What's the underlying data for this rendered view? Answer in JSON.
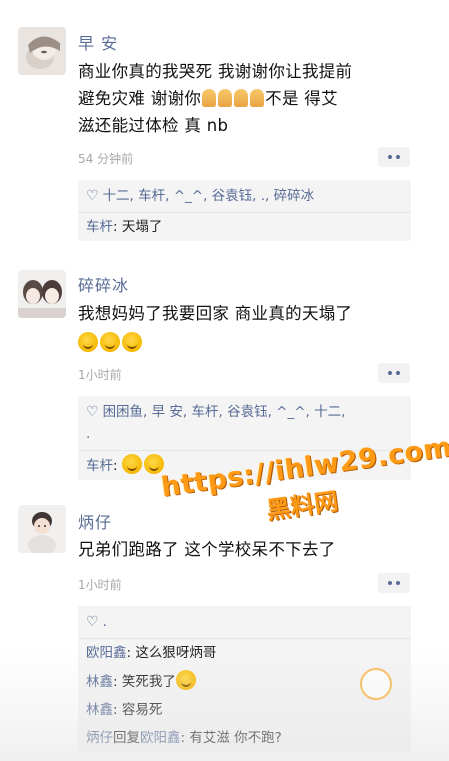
{
  "posts": [
    {
      "name": "早 安",
      "content_lines": [
        "商业你真的我哭死  我谢谢你让我提前",
        "避免灾难 谢谢你",
        "不是 得艾",
        "滋还能过体检 真 nb"
      ],
      "time": "54 分钟前",
      "likes": "十二, 车杆, ^_^, 谷袁钰, ., 碎碎冰",
      "comments": [
        {
          "name": "车杆",
          "sep": ": ",
          "text": "天塌了"
        }
      ]
    },
    {
      "name": "碎碎冰",
      "content_lines": [
        "我想妈妈了我要回家 商业真的天塌了"
      ],
      "time": "1小时前",
      "likes_line1": "困困鱼, 早 安, 车杆, 谷袁钰, ^_^, 十二,",
      "likes_line2": ".",
      "comments": [
        {
          "name": "车杆",
          "sep": ": ",
          "text": ""
        }
      ]
    },
    {
      "name": "炳仔",
      "content_lines": [
        "兄弟们跑路了 这个学校呆不下去了"
      ],
      "time": "1小时前",
      "likes": ".",
      "comments": [
        {
          "name": "欧阳鑫",
          "sep": ": ",
          "text": "这么狠呀炳哥"
        },
        {
          "name": "林鑫",
          "sep": ": ",
          "text": "笑死我了"
        },
        {
          "name": "林鑫",
          "sep": ": ",
          "text": "容易死"
        },
        {
          "name": "炳仔",
          "reply": "回复",
          "reply_to": "欧阳鑫",
          "sep": ": ",
          "text": "有艾滋 你不跑?"
        }
      ]
    }
  ],
  "watermark": {
    "url": "https://ihlw29.com",
    "cn": "黑料网"
  },
  "colors": {
    "link": "#576b95",
    "watermark": "#ff9a16"
  }
}
